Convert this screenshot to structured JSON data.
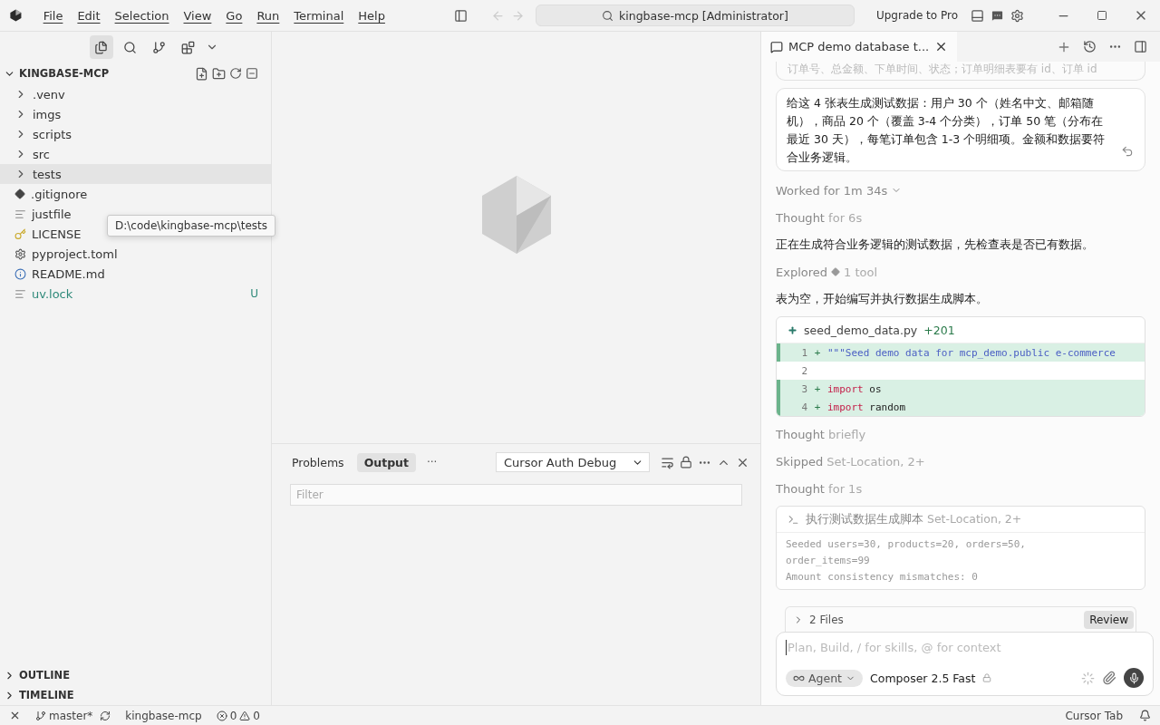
{
  "menu": [
    "File",
    "Edit",
    "Selection",
    "View",
    "Go",
    "Run",
    "Terminal",
    "Help"
  ],
  "command_center": {
    "text": "kingbase-mcp [Administrator]"
  },
  "upgrade": "Upgrade to Pro",
  "activity": [
    {
      "kind": "explorer",
      "selected": true
    },
    {
      "kind": "search",
      "selected": false
    },
    {
      "kind": "scm",
      "selected": false
    },
    {
      "kind": "extensions",
      "selected": false
    }
  ],
  "explorer": {
    "title": "KINGBASE-MCP",
    "expanded": true,
    "items": [
      {
        "name": ".venv",
        "kind": "folder",
        "selected": false
      },
      {
        "name": "imgs",
        "kind": "folder",
        "selected": false
      },
      {
        "name": "scripts",
        "kind": "folder",
        "selected": false
      },
      {
        "name": "src",
        "kind": "folder",
        "selected": false
      },
      {
        "name": "tests",
        "kind": "folder",
        "selected": true
      },
      {
        "name": ".gitignore",
        "kind": "git",
        "selected": false
      },
      {
        "name": "justfile",
        "kind": "text",
        "selected": false
      },
      {
        "name": "LICENSE",
        "kind": "license",
        "selected": false
      },
      {
        "name": "pyproject.toml",
        "kind": "config",
        "selected": false
      },
      {
        "name": "README.md",
        "kind": "info",
        "selected": false
      },
      {
        "name": "uv.lock",
        "kind": "text",
        "selected": false,
        "badge": "U"
      }
    ],
    "tooltip": "D:\\code\\kingbase-mcp\\tests",
    "sections": [
      {
        "title": "OUTLINE",
        "expanded": false
      },
      {
        "title": "TIMELINE",
        "expanded": false
      }
    ]
  },
  "panel": {
    "tabs": [
      {
        "label": "Problems",
        "selected": false
      },
      {
        "label": "Output",
        "selected": true
      }
    ],
    "more": "···",
    "channel": "Cursor Auth Debug",
    "filter_placeholder": "Filter"
  },
  "chat": {
    "tab": "MCP demo database t...",
    "cut_message": "订单号、总金额、下单时间、状态；订单明细表要有 id、订单 id",
    "message": "给这 4 张表生成测试数据：用户 30 个（姓名中文、邮箱随机），商品 20 个（覆盖 3-4 个分类），订单 50 笔（分布在最近 30 天），每笔订单包含 1-3 个明细项。金额和数据要符合业务逻辑。",
    "items": [
      {
        "kind": "worked",
        "label": "Worked for 1m 34s"
      },
      {
        "kind": "status",
        "label": "Thought",
        "detail": "for 6s"
      },
      {
        "kind": "text",
        "text": "正在生成符合业务逻辑的测试数据，先检查表是否已有数据。"
      },
      {
        "kind": "tool",
        "label": "Explored",
        "detail": "1 tool"
      },
      {
        "kind": "text",
        "text": "表为空，开始编写并执行数据生成脚本。"
      },
      {
        "kind": "diff",
        "file": "seed_demo_data.py",
        "added": "+201",
        "lines": [
          {
            "number": "1",
            "added": true,
            "sign": "+",
            "tokens": [
              {
                "kind": "string",
                "text": "\"\"\"Seed demo data for mcp_demo.public e-commerce"
              }
            ]
          },
          {
            "number": "2",
            "added": false
          },
          {
            "number": "3",
            "added": true,
            "sign": "+",
            "tokens": [
              {
                "kind": "keyword",
                "text": "import"
              },
              {
                "kind": "plain",
                "text": " os"
              }
            ]
          },
          {
            "number": "4",
            "added": true,
            "sign": "+",
            "tokens": [
              {
                "kind": "keyword",
                "text": "import"
              },
              {
                "kind": "plain",
                "text": " random"
              }
            ]
          }
        ]
      },
      {
        "kind": "status",
        "label": "Thought",
        "detail": "briefly"
      },
      {
        "kind": "status",
        "label": "Skipped",
        "detail": "Set-Location, 2+"
      },
      {
        "kind": "status",
        "label": "Thought",
        "detail": "for 1s"
      },
      {
        "kind": "terminal",
        "title": "执行测试数据生成脚本",
        "detail": "Set-Location, 2+",
        "output": [
          "Seeded users=30, products=20, orders=50,",
          "order_items=99",
          "Amount consistency mismatches: 0"
        ]
      }
    ],
    "files": "2 Files",
    "review": "Review",
    "composer": {
      "placeholder": "Plan, Build, / for skills, @ for context",
      "mode": "Agent",
      "model": "Composer 2.5 Fast"
    }
  },
  "status_bar": {
    "branch": "master*",
    "project": "kingbase-mcp",
    "errors": "0",
    "warnings": "0",
    "right": "Cursor Tab"
  }
}
